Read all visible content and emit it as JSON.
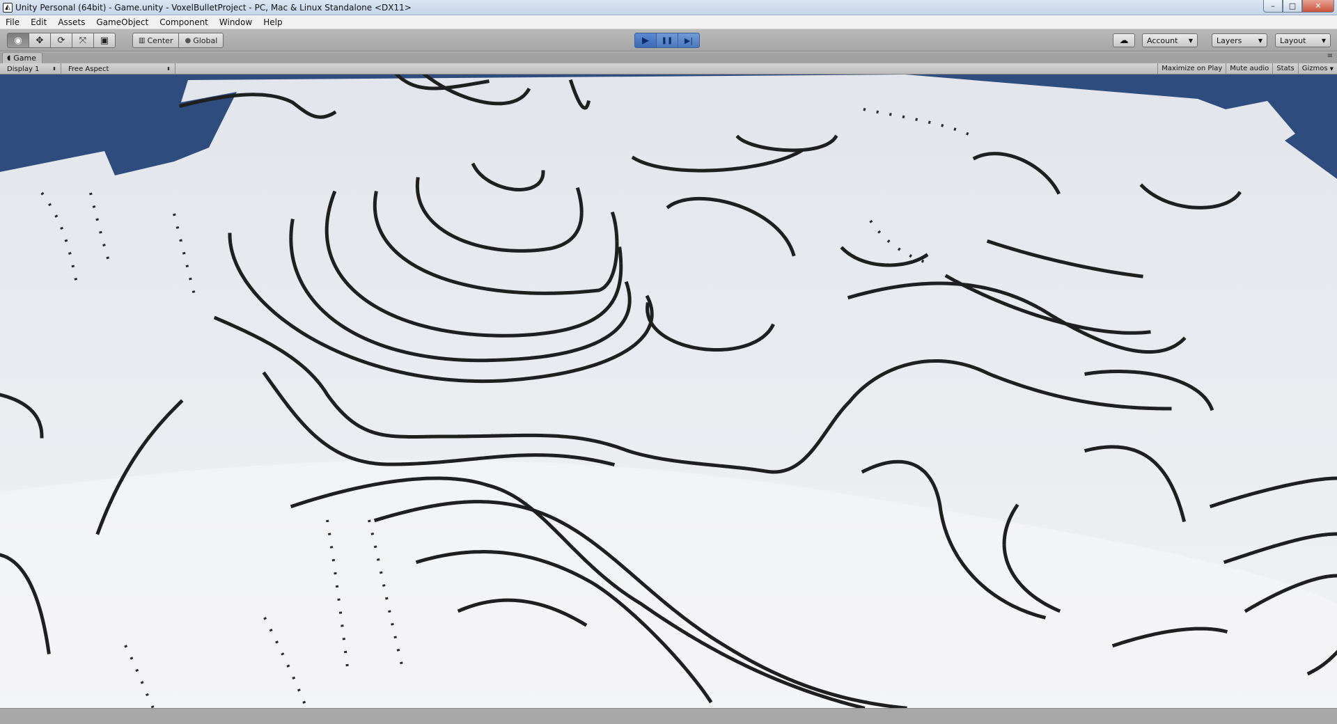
{
  "window": {
    "title": "Unity Personal (64bit) - Game.unity - VoxelBulletProject - PC, Mac & Linux Standalone <DX11>",
    "controls": {
      "minimize": "–",
      "maximize": "□",
      "close": "✕"
    }
  },
  "menubar": {
    "items": [
      "File",
      "Edit",
      "Assets",
      "GameObject",
      "Component",
      "Window",
      "Help"
    ]
  },
  "toolbar": {
    "tools": [
      {
        "name": "view-tool",
        "icon": "eye-icon",
        "glyph": "◉"
      },
      {
        "name": "move-tool",
        "icon": "move-icon",
        "glyph": "✥"
      },
      {
        "name": "rotate-tool",
        "icon": "rotate-icon",
        "glyph": "⟳"
      },
      {
        "name": "scale-tool",
        "icon": "scale-icon",
        "glyph": "⤧"
      },
      {
        "name": "rect-tool",
        "icon": "rect-icon",
        "glyph": "▣"
      }
    ],
    "pivot": {
      "center": "Center",
      "global": "Global",
      "center_glyph": "▥",
      "global_glyph": "●"
    },
    "playback": {
      "play": "▶",
      "pause": "❚❚",
      "step": "▶|"
    },
    "cloud_glyph": "☁",
    "account": "Account",
    "layers": "Layers",
    "layout": "Layout"
  },
  "game_panel": {
    "tab": "Game",
    "display": "Display 1",
    "aspect": "Free Aspect",
    "toggles": {
      "maximize": "Maximize on Play",
      "mute": "Mute audio",
      "stats": "Stats",
      "gizmos": "Gizmos"
    }
  },
  "colors": {
    "sky": "#2f4c7e",
    "terrain": "#e4e7ec",
    "contour": "#1d1d1d",
    "play_accent": "#4b79bd"
  }
}
